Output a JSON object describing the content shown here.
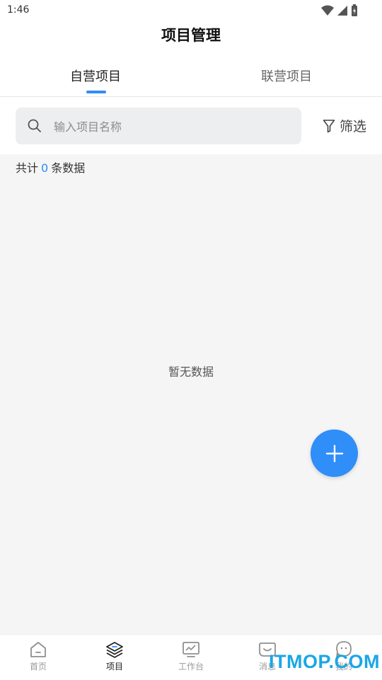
{
  "status_bar": {
    "time": "1:46"
  },
  "app_bar": {
    "title": "项目管理"
  },
  "tabs": [
    {
      "label": "自营项目",
      "active": true
    },
    {
      "label": "联营项目",
      "active": false
    }
  ],
  "search": {
    "placeholder": "输入项目名称",
    "value": ""
  },
  "filter": {
    "label": "筛选"
  },
  "summary": {
    "prefix": "共计",
    "count": "0",
    "suffix": "条数据"
  },
  "empty_state": {
    "text": "暂无数据"
  },
  "bottom_nav": [
    {
      "label": "首页",
      "icon": "home-icon",
      "active": false
    },
    {
      "label": "项目",
      "icon": "layers-icon",
      "active": true
    },
    {
      "label": "工作台",
      "icon": "monitor-icon",
      "active": false
    },
    {
      "label": "消息",
      "icon": "smile-message-icon",
      "active": false
    },
    {
      "label": "我的",
      "icon": "profile-icon",
      "active": false
    }
  ],
  "watermark": "ITMOP.COM",
  "colors": {
    "accent": "#2f8ef8",
    "background": "#f5f5f6",
    "watermark": "#1ba6e6"
  }
}
